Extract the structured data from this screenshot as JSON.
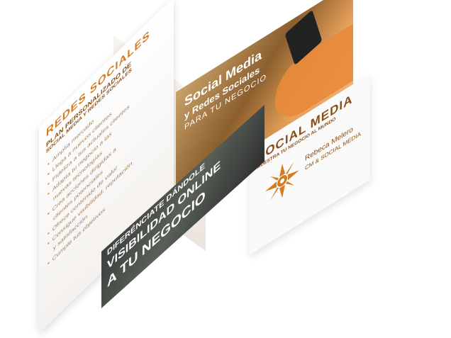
{
  "left_panel": {
    "heading": "REDES SOCIALES",
    "subheading_1": "PLAN PERSONALIZADO DE",
    "subheading_2": "SOCIAL MEDIA Y REDES SOCIALES",
    "items": [
      "Amplía mercado",
      "Llega a nuevos clientes",
      "Fideliza a tus actuales clientes",
      "Adapta tu negocio a las",
      "nuevas tecnologías",
      "Crea acciones dirigidas a",
      "clientes potenciales",
      "Ofrece contenido de valor",
      "Consigue visibilidad, reputación",
      "y satisfacción",
      "Cumple tus objetivos"
    ]
  },
  "lower_panel": {
    "line_1": "DIFERÉNCIATE DÁNDOLE",
    "line_2": "VISIBILIDAD ONLINE",
    "line_3": "A TU NEGOCIO"
  },
  "photo_panel": {
    "line_1": "Social Media",
    "line_2": "y Redes Sociales",
    "line_3": "PARA TU NEGOCIO"
  },
  "right_panel": {
    "title": "SOCIAL MEDIA",
    "tagline": "MUESTRA TU NEGOCIO AL MUNDO",
    "name": "Rebeca Melero",
    "role": "CM & SOCIAL MEDIA"
  },
  "colors": {
    "accent": "#d47a1f",
    "brown": "#8a4d14",
    "dark_photo": "#3b3f3d"
  },
  "icons": {
    "logo": "mandala-icon"
  }
}
